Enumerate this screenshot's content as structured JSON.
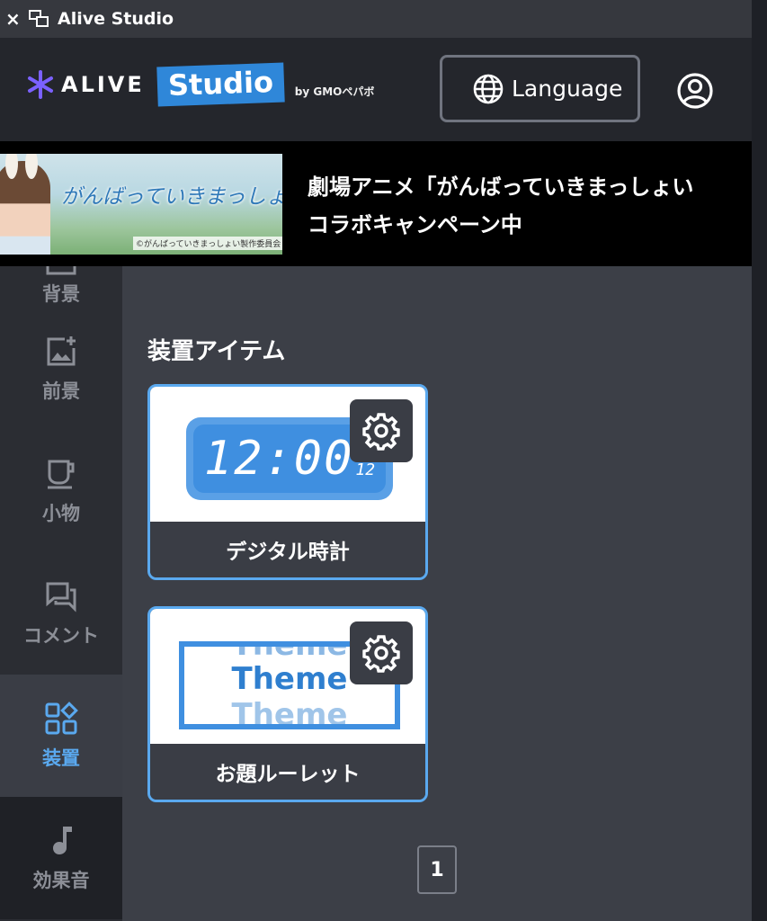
{
  "window": {
    "title": "Alive Studio",
    "close_glyph": "×"
  },
  "header": {
    "logo_alive": "ALIVE",
    "logo_studio": "Studio",
    "logo_by": "by GMOペパボ",
    "language_label": "Language"
  },
  "banner": {
    "line1": "劇場アニメ「がんばっていきまっしょい",
    "line2": "コラボキャンペーン中",
    "image_title": "がんばっていきまっしょい",
    "image_credit": "©がんばっていきまっしょい製作委員会"
  },
  "sidebar": {
    "items": [
      {
        "label": "背景",
        "icon": "image-icon"
      },
      {
        "label": "前景",
        "icon": "add-image-icon"
      },
      {
        "label": "小物",
        "icon": "cup-icon"
      },
      {
        "label": "コメント",
        "icon": "comment-icon"
      },
      {
        "label": "装置",
        "icon": "widgets-icon",
        "active": true
      },
      {
        "label": "効果音",
        "icon": "music-note-icon"
      }
    ]
  },
  "main": {
    "section_title": "装置アイテム",
    "cards": [
      {
        "name": "デジタル時計",
        "clock_digits": "12:00",
        "clock_seconds": "12"
      },
      {
        "name": "お題ルーレット",
        "theme_word": "Theme"
      }
    ],
    "pagination": {
      "current_page": "1"
    }
  },
  "colors": {
    "accent": "#5aa9ef",
    "background": "#3c3f47",
    "sidebar": "#2b2d33"
  }
}
